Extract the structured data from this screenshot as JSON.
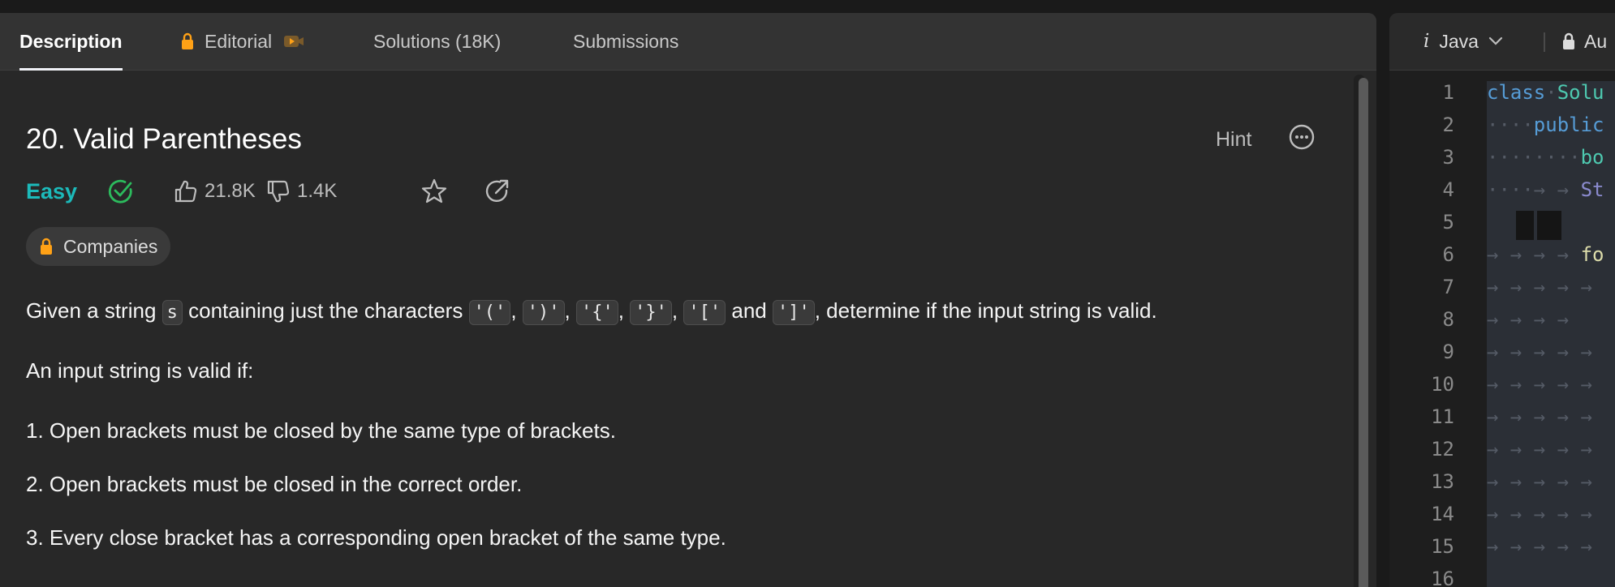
{
  "tabs": [
    {
      "label": "Description"
    },
    {
      "label": "Editorial"
    },
    {
      "label": "Solutions (18K)"
    },
    {
      "label": "Submissions"
    }
  ],
  "problem": {
    "title": "20. Valid Parentheses",
    "hint_label": "Hint",
    "difficulty": "Easy",
    "likes": "21.8K",
    "dislikes": "1.4K",
    "companies_label": "Companies"
  },
  "description": {
    "p1_prefix": "Given a string",
    "p1_code_s": "s",
    "p1_mid": "containing just the characters",
    "chars": [
      "'('",
      "')'",
      "'{'",
      "'}'",
      "'['",
      "']'"
    ],
    "p1_and": "and",
    "p1_suffix": ", determine if the input string is valid.",
    "p2": "An input string is valid if:",
    "rules": [
      "1. Open brackets must be closed by the same type of brackets.",
      "2. Open brackets must be closed in the correct order.",
      "3. Every close bracket has a corresponding open bracket of the same type."
    ]
  },
  "editor": {
    "language_icon": "i",
    "language": "Java",
    "mode_label": "Au",
    "line_numbers": [
      "1",
      "2",
      "3",
      "4",
      "5",
      "6",
      "7",
      "8",
      "9",
      "10",
      "11",
      "12",
      "13",
      "14",
      "15",
      "16"
    ],
    "code": {
      "l1_kw": "class",
      "l1_sep": "·",
      "l1_cls": "Solu",
      "l2_ws": "····",
      "l2_kw": "public",
      "l3_ws": "········",
      "l3_kw": "bo",
      "l4_ws": "····→ → ",
      "l4_typ": "St",
      "l6_ws": "→ → → → ",
      "l6_fn": "fo",
      "tab_arrows": "→ → → → →",
      "tab_arrows_short": "→ → → →"
    }
  },
  "colors": {
    "accent_easy": "#1cbaba",
    "check_green": "#2cbb5d",
    "lock_orange": "#ffa116"
  }
}
